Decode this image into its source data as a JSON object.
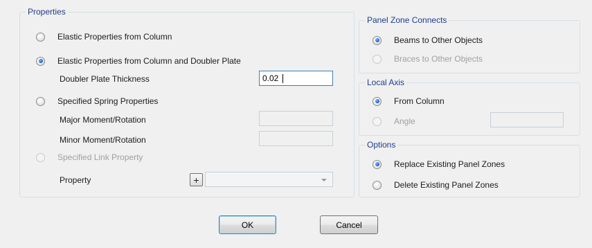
{
  "properties": {
    "title": "Properties",
    "elastic_from_column": "Elastic Properties from Column",
    "elastic_column_doubler": "Elastic Properties from Column and Doubler Plate",
    "doubler_thickness_label": "Doubler Plate Thickness",
    "doubler_thickness_value": "0.02",
    "specified_spring": "Specified Spring Properties",
    "major_label": "Major Moment/Rotation",
    "major_value": "",
    "minor_label": "Minor Moment/Rotation",
    "minor_value": "",
    "specified_link": "Specified Link Property",
    "property_label": "Property",
    "add_symbol": "+",
    "property_value": ""
  },
  "panel_zone_connects": {
    "title": "Panel Zone Connects",
    "beams": "Beams to Other Objects",
    "braces": "Braces to Other Objects"
  },
  "local_axis": {
    "title": "Local Axis",
    "from_column": "From Column",
    "angle": "Angle",
    "angle_value": ""
  },
  "options": {
    "title": "Options",
    "replace": "Replace Existing Panel Zones",
    "delete": "Delete Existing Panel Zones"
  },
  "buttons": {
    "ok": "OK",
    "cancel": "Cancel"
  },
  "colors": {
    "group_title": "#1e3c8c",
    "radio_selected": "#2667d6",
    "disabled_text": "#a0a0a0"
  }
}
